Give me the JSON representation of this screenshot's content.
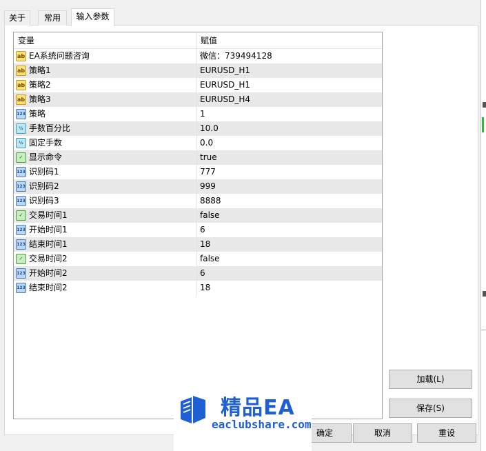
{
  "tabs": [
    "关于",
    "常用",
    "输入参数"
  ],
  "active_tab": "输入参数",
  "table": {
    "headers": [
      "变量",
      "赋值"
    ],
    "rows": [
      {
        "icon": "ab-text-icon",
        "name": "EA系统问题咨询",
        "value": "微信：739494128"
      },
      {
        "icon": "ab-text-icon",
        "name": "策略1",
        "value": "EURUSD_H1"
      },
      {
        "icon": "ab-text-icon",
        "name": "策略2",
        "value": "EURUSD_H1"
      },
      {
        "icon": "ab-text-icon",
        "name": "策略3",
        "value": "EURUSD_H4"
      },
      {
        "icon": "integer-icon",
        "name": "策略",
        "value": "1"
      },
      {
        "icon": "double-icon",
        "name": "手数百分比",
        "value": "10.0"
      },
      {
        "icon": "double-icon",
        "name": "固定手数",
        "value": "0.0"
      },
      {
        "icon": "bool-icon",
        "name": "显示命令",
        "value": "true"
      },
      {
        "icon": "integer-icon",
        "name": "识别码1",
        "value": "777"
      },
      {
        "icon": "integer-icon",
        "name": "识别码2",
        "value": "999"
      },
      {
        "icon": "integer-icon",
        "name": "识别码3",
        "value": "8888"
      },
      {
        "icon": "bool-icon",
        "name": "交易时间1",
        "value": "false"
      },
      {
        "icon": "integer-icon",
        "name": "开始时间1",
        "value": "6"
      },
      {
        "icon": "integer-icon",
        "name": "结束时间1",
        "value": "18"
      },
      {
        "icon": "bool-icon",
        "name": "交易时间2",
        "value": "false"
      },
      {
        "icon": "integer-icon",
        "name": "开始时间2",
        "value": "6"
      },
      {
        "icon": "integer-icon",
        "name": "结束时间2",
        "value": "18"
      }
    ]
  },
  "icon_labels": {
    "ab-text-icon": "ab",
    "integer-icon": "123",
    "double-icon": "½",
    "bool-icon": "✓"
  },
  "buttons": {
    "load": "加载(L)",
    "save": "保存(S)",
    "ok": "确定",
    "cancel": "取消",
    "reset": "重设"
  },
  "watermark": {
    "title": "精品EA",
    "url": "eaclubshare.com"
  }
}
